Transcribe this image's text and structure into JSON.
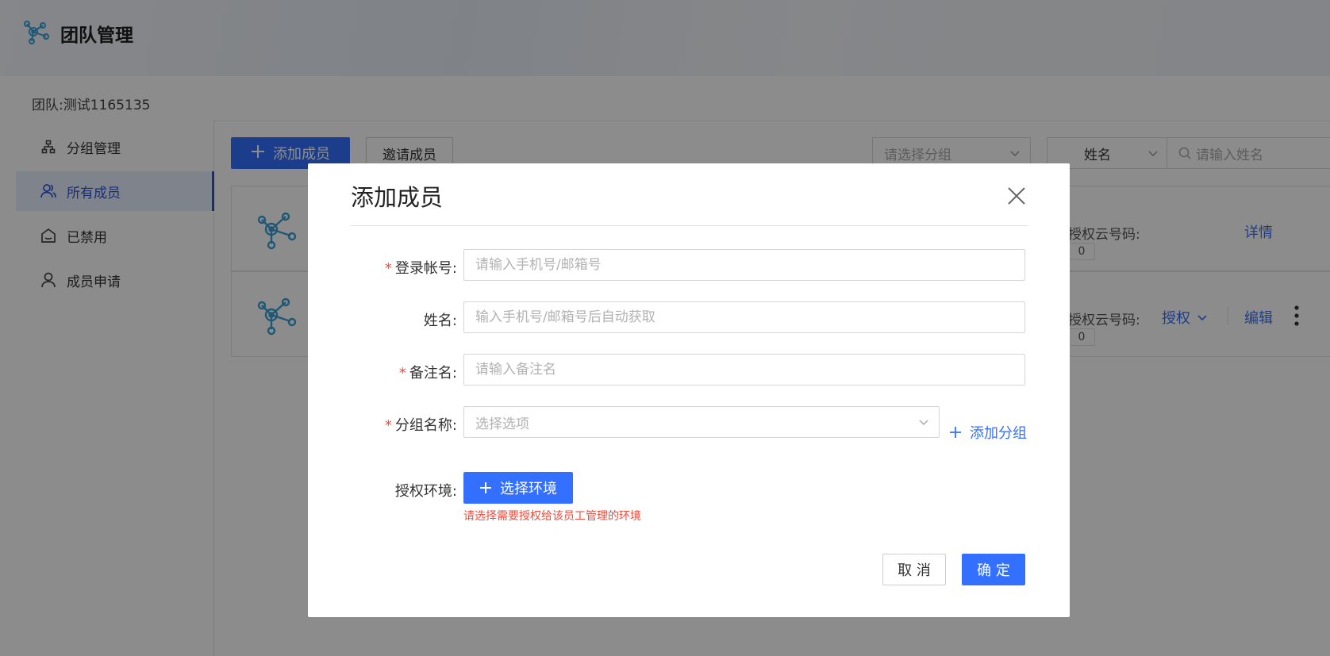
{
  "header": {
    "app_title": "团队管理",
    "logo_icon": "network-nodes-icon"
  },
  "team": {
    "label": "团队:",
    "name": "测试1165135"
  },
  "sidebar": {
    "items": [
      {
        "label": "分组管理",
        "icon": "group-tree-icon",
        "active": false
      },
      {
        "label": "所有成员",
        "icon": "users-icon",
        "active": true
      },
      {
        "label": "已禁用",
        "icon": "disabled-home-icon",
        "active": false
      },
      {
        "label": "成员申请",
        "icon": "user-icon",
        "active": false
      }
    ]
  },
  "toolbar": {
    "add_member_label": "添加成员",
    "invite_member_label": "邀请成员",
    "group_select_placeholder": "请选择分组",
    "search_field_value": "姓名",
    "search_placeholder": "请输入姓名"
  },
  "members": [
    {
      "auth_code_label": "授权云号码:",
      "auth_code_value": "0",
      "actions": [
        "详情"
      ]
    },
    {
      "auth_code_label": "授权云号码:",
      "auth_code_value": "0",
      "actions": [
        "授权",
        "编辑"
      ]
    }
  ],
  "modal": {
    "title": "添加成员",
    "fields": {
      "account": {
        "label": "登录帐号:",
        "placeholder": "请输入手机号/邮箱号",
        "required": true
      },
      "name": {
        "label": "姓名:",
        "placeholder": "输入手机号/邮箱号后自动获取",
        "required": false
      },
      "remark": {
        "label": "备注名:",
        "placeholder": "请输入备注名",
        "required": true
      },
      "group": {
        "label": "分组名称:",
        "placeholder": "选择选项",
        "required": true,
        "add_label": "添加分组"
      },
      "env": {
        "label": "授权环境:",
        "button_label": "选择环境",
        "hint": "请选择需要授权给该员工管理的环境"
      }
    },
    "cancel_label": "取 消",
    "ok_label": "确 定"
  },
  "colors": {
    "primary": "#3470ff",
    "danger": "#f04a3b",
    "mask": "rgba(0,0,0,0.45)"
  }
}
